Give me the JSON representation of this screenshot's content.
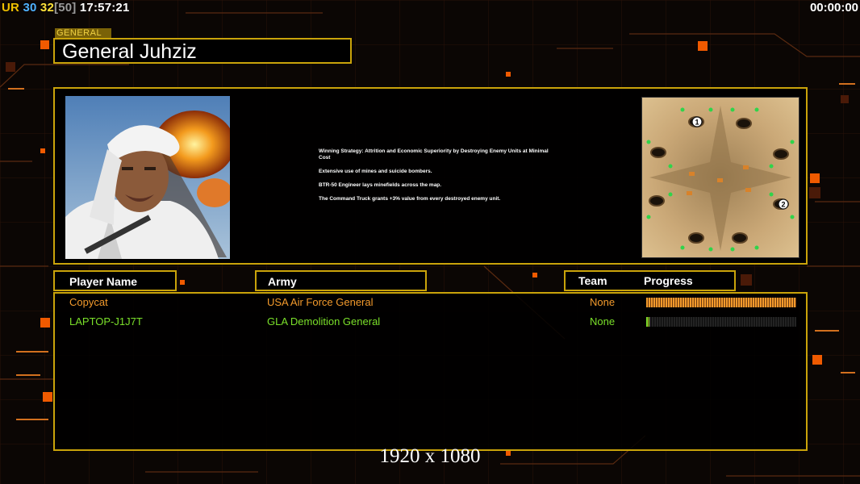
{
  "hud": {
    "ur_label": "UR",
    "fps": "30",
    "current": "32",
    "cap": "[50]",
    "clock": "17:57:21",
    "timer": "00:00:00"
  },
  "general": {
    "tag": "GENERAL",
    "name": "General Juhziz"
  },
  "strategy": [
    "Winning Strategy: Attrition and Economic Superiority by Destroying Enemy Units at Minimal Cost",
    "Extensive use of mines and suicide bombers.",
    "BTR-50 Engineer lays minefields across the map.",
    "The Command Truck grants +3% value from every destroyed enemy unit."
  ],
  "minimap": {
    "start_positions": [
      "1",
      "2"
    ]
  },
  "columns": {
    "player": "Player Name",
    "army": "Army",
    "team": "Team",
    "progress": "Progress"
  },
  "players": [
    {
      "name": "Copycat",
      "army": "USA Air Force General",
      "team": "None",
      "progress": 1.0,
      "color": "#f39a2c"
    },
    {
      "name": "LAPTOP-J1J7T",
      "army": "GLA Demolition General",
      "team": "None",
      "progress": 0.02,
      "color": "#7be02a"
    }
  ],
  "resolution": "1920 x 1080",
  "colors": {
    "frame": "#c9a30a",
    "accent_orange": "#f05a00"
  }
}
